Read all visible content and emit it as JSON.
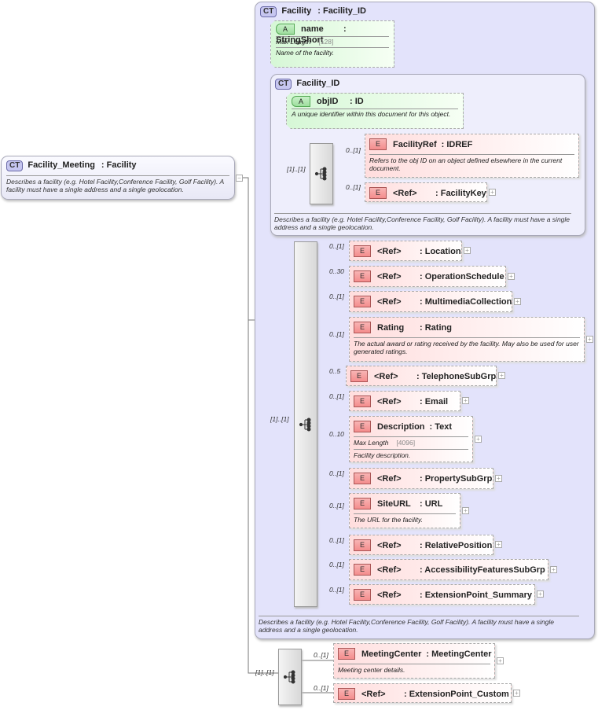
{
  "root": {
    "badge": "CT",
    "name": "Facility_Meeting",
    "type": ": Facility",
    "desc": "Describes a facility (e.g. Hotel Facility,Conference Facility, Golf Facility). A facility must have a single address and a single geolocation.",
    "collapse": "−"
  },
  "facility": {
    "badge": "CT",
    "name": "Facility",
    "type": ": Facility_ID",
    "desc": "Describes a facility (e.g. Hotel Facility,Conference Facility, Golf Facility).  A facility must have a single address and a single geolocation.",
    "seq_mult": "[1]..[1]"
  },
  "name_attr": {
    "badge": "A",
    "name": "name",
    "type": ": StringShort",
    "facet_label": "Max Length",
    "facet_value": "[128]",
    "desc": "Name of the facility."
  },
  "facility_id": {
    "badge": "CT",
    "name": "Facility_ID",
    "desc": "Describes a facility (e.g. Hotel Facility,Conference Facility, Golf Facility).  A facility must have a single address and a single geolocation.",
    "seq_mult": "[1]..[1]",
    "attr": {
      "badge": "A",
      "name": "objID",
      "type": ": ID",
      "desc": "A unique identifier within this document for this object."
    },
    "elements": [
      {
        "name": "FacilityRef",
        "type": ": IDREF",
        "mult": "0..[1]",
        "desc": "Refers to the obj ID on an object defined elsewhere in the current document."
      },
      {
        "name": "<Ref>",
        "type": ": FacilityKey",
        "mult": "0..[1]",
        "plus": "+"
      }
    ]
  },
  "elements": [
    {
      "name": "<Ref>",
      "type": ": Location",
      "mult": "0..[1]",
      "plus": "+"
    },
    {
      "name": "<Ref>",
      "type": ": OperationSchedule",
      "mult": "0..30",
      "plus": "+"
    },
    {
      "name": "<Ref>",
      "type": ": MultimediaCollection",
      "mult": "0..[1]",
      "plus": "+"
    },
    {
      "name": "Rating",
      "type": ": Rating",
      "mult": "0..[1]",
      "desc": "The actual award or rating received by the facility.  May also be used for user generated ratings.",
      "plus": "+"
    },
    {
      "name": "<Ref>",
      "type": ": TelephoneSubGrp",
      "mult": "0..5",
      "plus": "+"
    },
    {
      "name": "<Ref>",
      "type": ": Email",
      "mult": "0..[1]",
      "plus": "+"
    },
    {
      "name": "Description",
      "type": ": Text",
      "mult": "0..10",
      "facet_label": "Max Length",
      "facet_value": "[4096]",
      "desc": "Facility description.",
      "plus": "+"
    },
    {
      "name": "<Ref>",
      "type": ": PropertySubGrp",
      "mult": "0..[1]",
      "plus": "+"
    },
    {
      "name": "SiteURL",
      "type": ": URL",
      "mult": "0..[1]",
      "desc": "The URL for the facility.",
      "plus": "+"
    },
    {
      "name": "<Ref>",
      "type": ": RelativePosition",
      "mult": "0..[1]",
      "plus": "+"
    },
    {
      "name": "<Ref>",
      "type": ": AccessibilityFeaturesSubGrp",
      "mult": "0..[1]",
      "plus": "+"
    },
    {
      "name": "<Ref>",
      "type": ": ExtensionPoint_Summary",
      "mult": "0..[1]",
      "plus": "+"
    }
  ],
  "meeting": {
    "seq_mult": "[1]..[1]",
    "elements": [
      {
        "name": "MeetingCenter",
        "type": ": MeetingCenter",
        "mult": "0..[1]",
        "desc": "Meeting center details.",
        "plus": "+"
      },
      {
        "name": "<Ref>",
        "type": ": ExtensionPoint_Custom",
        "mult": "0..[1]",
        "plus": "+"
      }
    ]
  },
  "element_badge": "E"
}
